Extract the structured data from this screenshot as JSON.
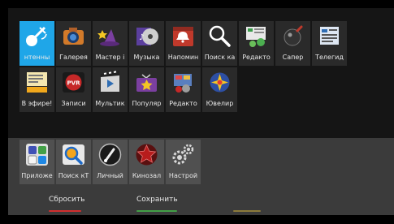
{
  "colors": {
    "accent_selected": "#1fa6e8",
    "reset_bar": "#d32f2f",
    "save_bar": "#43a047",
    "extra_bar": "#8c7a3b"
  },
  "apps": [
    {
      "label": "Антенны",
      "visible_label": "нтенны",
      "icon": "antenna-icon",
      "selected": true
    },
    {
      "label": "Галерея",
      "icon": "camera-icon"
    },
    {
      "label": "Мастер і",
      "icon": "wizard-hat-icon"
    },
    {
      "label": "Музыка",
      "icon": "music-disc-icon"
    },
    {
      "label": "Напомин",
      "icon": "alarm-calendar-icon"
    },
    {
      "label": "Поиск ка",
      "icon": "magnifier-icon"
    },
    {
      "label": "Редакто",
      "icon": "list-editor-icon"
    },
    {
      "label": "Сапер",
      "icon": "mine-icon"
    },
    {
      "label": "Телегид",
      "icon": "tv-guide-icon"
    },
    {
      "label": "В эфире!",
      "icon": "on-air-icon"
    },
    {
      "label": "Записи",
      "icon": "pvr-icon"
    },
    {
      "label": "Мультик",
      "icon": "film-icon"
    },
    {
      "label": "Популяр",
      "icon": "popular-tv-icon"
    },
    {
      "label": "Редакто",
      "icon": "editor-icon"
    },
    {
      "label": "Ювелир",
      "icon": "jewel-icon"
    }
  ],
  "dock": [
    {
      "label": "Приложе",
      "icon": "apps-grid-icon"
    },
    {
      "label": "Поиск кТ",
      "icon": "search-tv-icon"
    },
    {
      "label": "Личный",
      "icon": "personal-needle-icon"
    },
    {
      "label": "Кинозал",
      "icon": "cinema-star-icon"
    },
    {
      "label": "Настрой",
      "icon": "settings-gears-icon"
    }
  ],
  "buttons": {
    "reset_label": "Сбросить",
    "save_label": "Сохранить",
    "extra_label": ""
  }
}
